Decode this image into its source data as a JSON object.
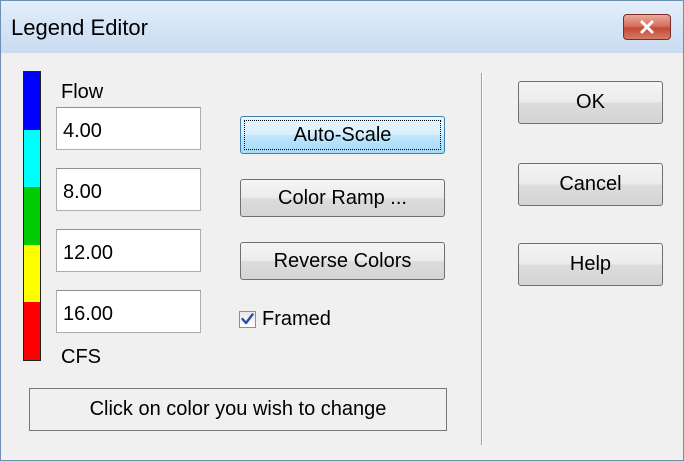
{
  "window": {
    "title": "Legend Editor",
    "close_icon": "close-x-icon"
  },
  "legend": {
    "variable": "Flow",
    "units": "CFS",
    "colors": [
      "#0000ff",
      "#00ffff",
      "#00cc00",
      "#ffff00",
      "#ff0000"
    ],
    "breakpoints": [
      "4.00",
      "8.00",
      "12.00",
      "16.00"
    ]
  },
  "buttons": {
    "auto_scale": "Auto-Scale",
    "color_ramp": "Color Ramp ...",
    "reverse_colors": "Reverse Colors",
    "ok": "OK",
    "cancel": "Cancel",
    "help": "Help"
  },
  "framed": {
    "label": "Framed",
    "checked": true
  },
  "hint": "Click on color you wish to change"
}
